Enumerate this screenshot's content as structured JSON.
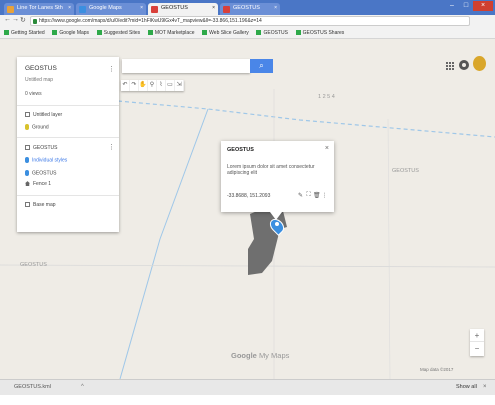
{
  "browser": {
    "tabs": [
      {
        "label": "Line Tor Lanes Sth",
        "favicon_color": "#e8a23a",
        "active": false
      },
      {
        "label": "Google Maps",
        "favicon_color": "#3b8fe0",
        "active": false
      },
      {
        "label": "GEOSTUS",
        "favicon_color": "#d9403a",
        "active": true
      },
      {
        "label": "GEOSTUS",
        "favicon_color": "#d9403a",
        "active": false
      }
    ],
    "tab_close_glyph": "×",
    "window_controls": [
      "–",
      "□",
      "×"
    ],
    "nav_icons": [
      "←",
      "→",
      "↻"
    ],
    "url": "https://www.google.com/maps/d/u/0/edit?mid=1hFlKwU9lGx4vT_mapview&ll=-33.866,151.196&z=14",
    "bookmarks": [
      "Getting Started",
      "Google Maps",
      "Suggested Sites",
      "MOT Marketplace",
      "Web Slice Gallery",
      "GEOSTUS",
      "GEOSTUS Shares"
    ]
  },
  "left_panel": {
    "title": "GEOSTUS",
    "subtitle": "Untitled map",
    "views_line": "0 views",
    "layers": [
      {
        "header": "Untitled layer",
        "items": [
          {
            "icon": "yellow-pin",
            "label": "Ground"
          }
        ]
      },
      {
        "header": "GEOSTUS",
        "items": [
          {
            "icon": "blue-pin",
            "label": "Individual styles"
          },
          {
            "icon": "blue-pin",
            "label": "GEOSTUS"
          },
          {
            "icon": "house",
            "label": "Fence 1"
          }
        ]
      }
    ],
    "base_map": "Base map",
    "menu_glyph": "⋮"
  },
  "search": {
    "placeholder": "",
    "button_glyph": "⌕"
  },
  "map_toolbar": [
    "↶",
    "↷",
    "✋",
    "⚲",
    "⌇",
    "▭",
    "⇲"
  ],
  "map_labels": [
    "1 2 5 4",
    "GEOSTUS",
    "GEOSTUS"
  ],
  "popup": {
    "title": "GEOSTUS",
    "description": "Lorem ipsum dolor sit amet consectetur adipiscing elit",
    "coordinates": "-33.8688, 151.2093",
    "actions": [
      "✎",
      "⛶",
      "🗑",
      "⋮"
    ],
    "close_glyph": "×"
  },
  "google_logo": {
    "brand": "Google",
    "product": "My Maps"
  },
  "zoom": {
    "in": "+",
    "out": "−"
  },
  "map_footer": "Map data ©2017",
  "downloads": {
    "item": "GEOSTUS.kml",
    "show_all": "Show all",
    "chevron": "^",
    "close": "×"
  }
}
